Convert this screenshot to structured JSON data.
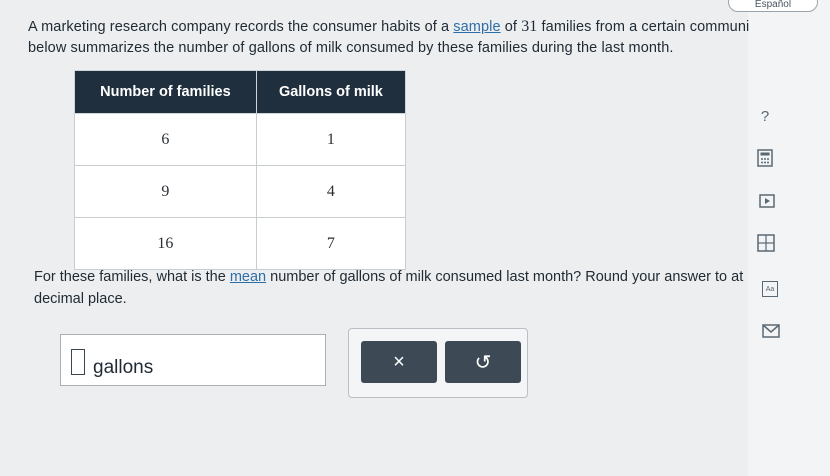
{
  "header": {
    "language_toggle": "Español"
  },
  "problem": {
    "text_a": "A marketing research company records the consumer habits of a ",
    "link_sample": "sample",
    "text_b": " of ",
    "n": "31",
    "text_c": " families from a certain communi",
    "line2": "below summarizes the number of gallons of milk consumed by these families during the last month."
  },
  "table": {
    "headers": [
      "Number of families",
      "Gallons of milk"
    ],
    "rows": [
      [
        "6",
        "1"
      ],
      [
        "9",
        "4"
      ],
      [
        "16",
        "7"
      ]
    ]
  },
  "question": {
    "text_a": "For these families, what is the ",
    "link_mean": "mean",
    "text_b": " number of gallons of milk consumed last month? Round your answer to at",
    "line2": "decimal place."
  },
  "answer": {
    "value": "",
    "unit": "gallons"
  },
  "buttons": {
    "clear": "×",
    "undo": "↺"
  },
  "side_tools": [
    "help-icon",
    "calculator-icon",
    "video-icon",
    "grid-calculator-icon",
    "text-aa-icon",
    "mail-icon"
  ],
  "side_help_label": "?",
  "side_aa_label": "Aa"
}
